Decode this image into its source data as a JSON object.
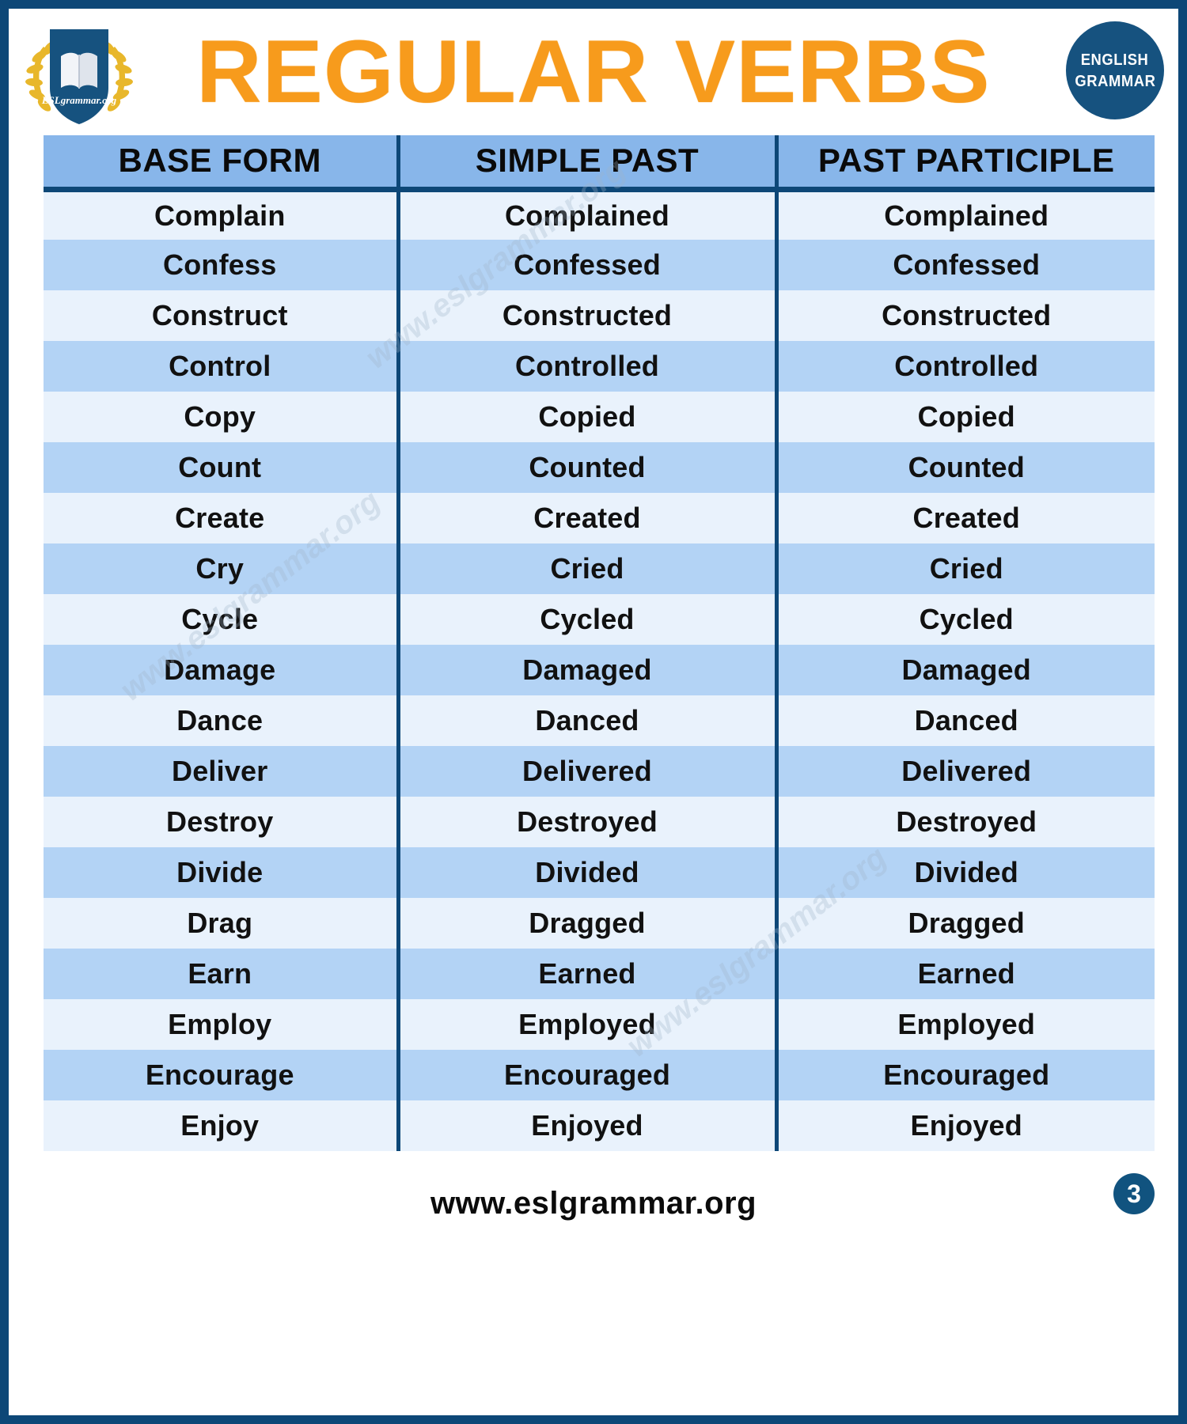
{
  "header": {
    "title": "REGULAR VERBS",
    "logo": {
      "icon": "book-shield-laurel-logo",
      "text": "ESLgrammar.org"
    },
    "badge": {
      "line1": "ENGLISH",
      "line2": "GRAMMAR"
    }
  },
  "table": {
    "columns": [
      "BASE FORM",
      "SIMPLE PAST",
      "PAST PARTICIPLE"
    ],
    "rows": [
      [
        "Complain",
        "Complained",
        "Complained"
      ],
      [
        "Confess",
        "Confessed",
        "Confessed"
      ],
      [
        "Construct",
        "Constructed",
        "Constructed"
      ],
      [
        "Control",
        "Controlled",
        "Controlled"
      ],
      [
        "Copy",
        "Copied",
        "Copied"
      ],
      [
        "Count",
        "Counted",
        "Counted"
      ],
      [
        "Create",
        "Created",
        "Created"
      ],
      [
        "Cry",
        "Cried",
        "Cried"
      ],
      [
        "Cycle",
        "Cycled",
        "Cycled"
      ],
      [
        "Damage",
        "Damaged",
        "Damaged"
      ],
      [
        "Dance",
        "Danced",
        "Danced"
      ],
      [
        "Deliver",
        "Delivered",
        "Delivered"
      ],
      [
        "Destroy",
        "Destroyed",
        "Destroyed"
      ],
      [
        "Divide",
        "Divided",
        "Divided"
      ],
      [
        "Drag",
        "Dragged",
        "Dragged"
      ],
      [
        "Earn",
        "Earned",
        "Earned"
      ],
      [
        "Employ",
        "Employed",
        "Employed"
      ],
      [
        "Encourage",
        "Encouraged",
        "Encouraged"
      ],
      [
        "Enjoy",
        "Enjoyed",
        "Enjoyed"
      ]
    ]
  },
  "watermarks": [
    "www.eslgrammar.org",
    "www.eslgrammar.org",
    "www.eslgrammar.org"
  ],
  "footer": {
    "url": "www.eslgrammar.org",
    "page_number": "3"
  },
  "colors": {
    "frame": "#0d4777",
    "title": "#F79B1C",
    "header_row": "#88b6ea",
    "row_odd": "#e9f2fc",
    "row_even": "#b3d3f5",
    "badge": "#16527F"
  }
}
